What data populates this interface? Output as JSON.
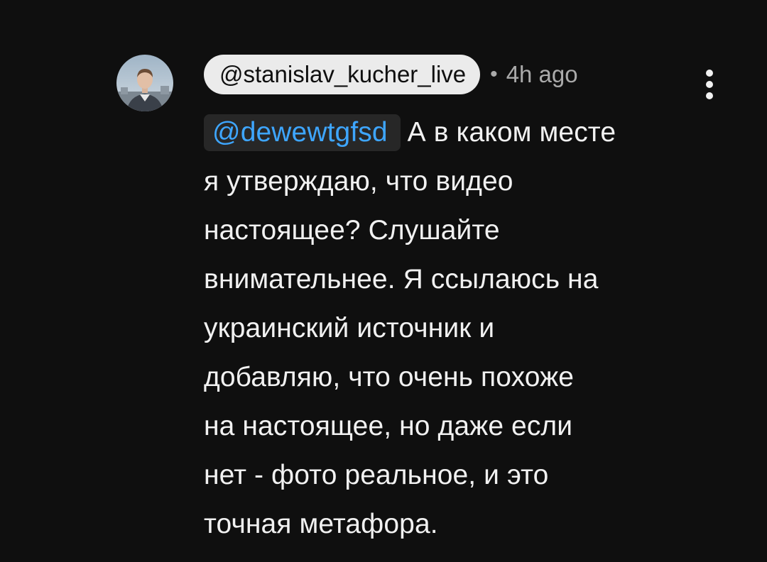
{
  "comment": {
    "author_handle": "@stanislav_kucher_live",
    "separator": "•",
    "timestamp": "4h ago",
    "mention": "@dewewtgfsd",
    "text_lines": [
      "А в каком месте",
      "я утверждаю, что видео",
      "настоящее? Слушайте",
      "внимательнее. Я ссылаюсь на",
      "украинский источник и",
      "добавляю, что очень похоже",
      "на настоящее, но даже если",
      "нет - фото реальное, и это",
      "точная метафора."
    ],
    "avatar_icon": "user-avatar-photo",
    "menu_icon": "more-vertical-icon"
  },
  "colors": {
    "background": "#0f0f0f",
    "text": "#f1f1f1",
    "secondary_text": "#aaaaaa",
    "mention_text": "#3ea6ff",
    "mention_bg": "#272727",
    "author_chip_bg": "#ebebeb"
  }
}
